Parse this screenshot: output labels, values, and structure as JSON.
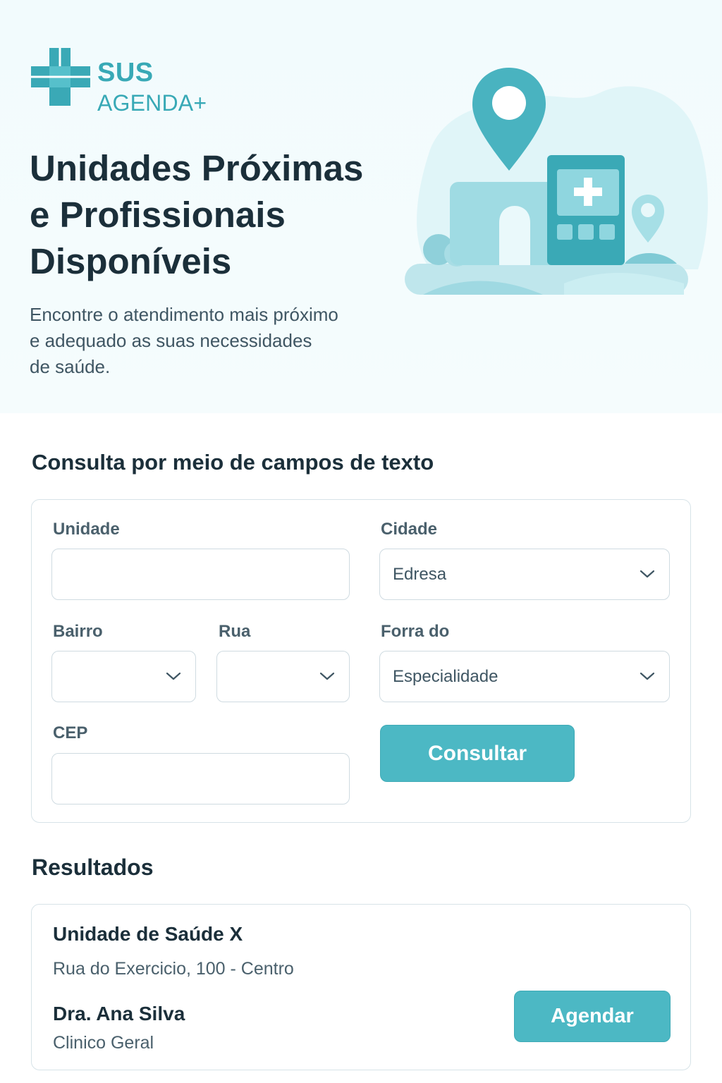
{
  "brand": {
    "name_line1": "SUS",
    "name_line2": "AGENDA+",
    "color": "#38a9b6"
  },
  "hero": {
    "title_lines": [
      "Unidades Próximas",
      "e Profissionais",
      "Disponíveis"
    ],
    "subtitle_lines": [
      "Encontre o atendimento mais próximo",
      "e adequado as suas necessidades",
      "de saúde."
    ],
    "illustration": "clinic-with-location-pins"
  },
  "search": {
    "section_title": "Consulta por meio de campos de texto",
    "unidade": {
      "label": "Unidade",
      "value": ""
    },
    "cidade": {
      "label": "Cidade",
      "value": "Edresa"
    },
    "bairro": {
      "label": "Bairro",
      "value": ""
    },
    "rua": {
      "label": "Rua",
      "value": ""
    },
    "forra": {
      "label": "Forra do",
      "value": "Especialidade"
    },
    "cep": {
      "label": "CEP",
      "value": ""
    },
    "submit_label": "Consultar"
  },
  "results": {
    "title": "Resultados",
    "items": [
      {
        "unit": "Unidade de Saúde X",
        "address": "Rua do Exercicio, 100 - Centro",
        "doctor": "Dra. Ana Silva",
        "specialty": "Clinico Geral",
        "action_label": "Agendar"
      }
    ]
  },
  "colors": {
    "accent": "#4cb8c4",
    "text_dark": "#1b2f3a",
    "text_muted": "#4a606c",
    "hero_bg": "#f2fbfd"
  }
}
